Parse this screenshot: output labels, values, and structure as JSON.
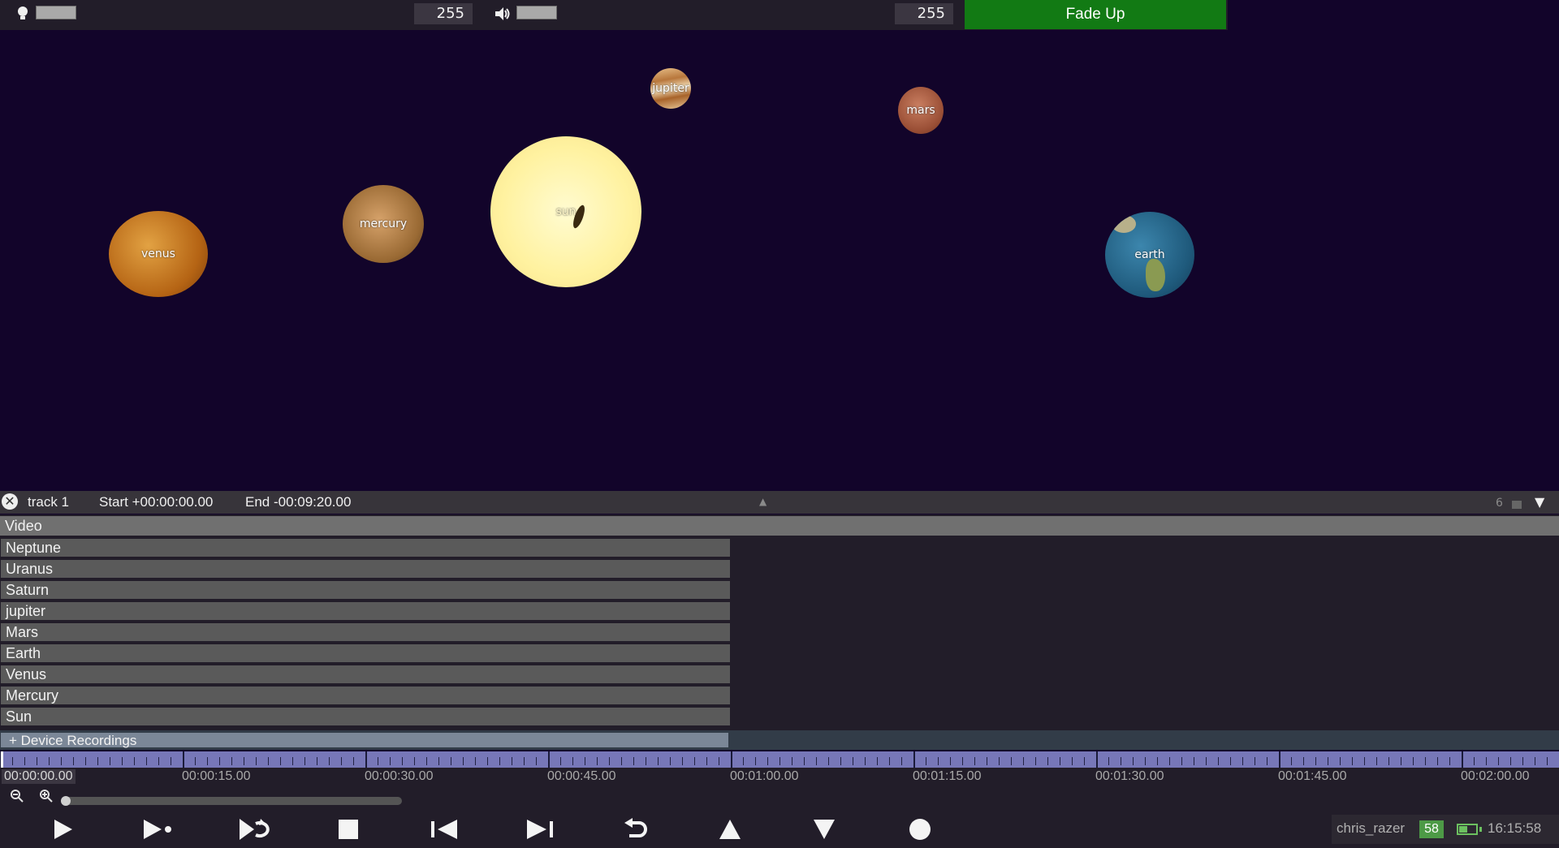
{
  "top_bar": {
    "light_value": "255",
    "volume_value": "255",
    "fade_button_label": "Fade Up",
    "fade_button_color": "#127a14"
  },
  "stage": {
    "planets": [
      {
        "name": "venus",
        "color": "#c77a22"
      },
      {
        "name": "mercury",
        "color": "#b78448"
      },
      {
        "name": "sun",
        "color": "#fff3a0"
      },
      {
        "name": "jupiter",
        "color": "#d9a56b"
      },
      {
        "name": "mars",
        "color": "#b46548"
      },
      {
        "name": "earth",
        "color": "#2b6a8d"
      }
    ]
  },
  "track": {
    "name": "track 1",
    "start": "Start +00:00:00.00",
    "end": "End -00:09:20.00",
    "count": "6"
  },
  "tracks": {
    "video_label": "Video",
    "rows": [
      "Neptune",
      "Uranus",
      "Saturn",
      "jupiter",
      "Mars",
      "Earth",
      "Venus",
      "Mercury",
      "Sun"
    ],
    "device_recordings": "+ Device Recordings"
  },
  "timeline": {
    "current_time": "00:00:00.00",
    "labels": [
      "00:00:15.00",
      "00:00:30.00",
      "00:00:45.00",
      "00:01:00.00",
      "00:01:15.00",
      "00:01:30.00",
      "00:01:45.00",
      "00:02:00.00"
    ]
  },
  "transport": {
    "buttons": [
      "play-icon",
      "play-to-cue-icon",
      "loop-icon",
      "stop-icon",
      "previous-icon",
      "next-icon",
      "undo-icon",
      "up-icon",
      "down-icon",
      "record-icon"
    ]
  },
  "status": {
    "username": "chris_razer",
    "badge": "58",
    "clock": "16:15:58"
  }
}
